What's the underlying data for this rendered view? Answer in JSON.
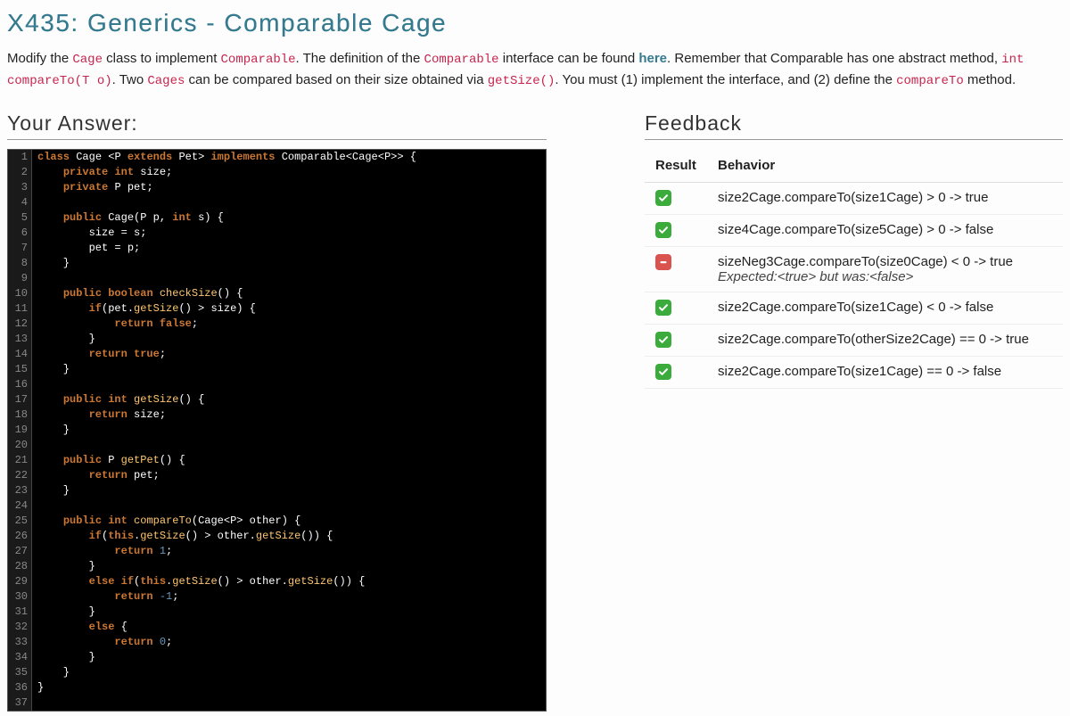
{
  "title": "X435: Generics - Comparable Cage",
  "instructions": {
    "p1a": "Modify the ",
    "code1": "Cage",
    "p1b": " class to implement ",
    "code2": "Comparable",
    "p1c": ". The definition of the ",
    "code3": "Comparable",
    "p1d": " interface can be found ",
    "here": "here",
    "p1e": ". Remember that Comparable has one abstract method, ",
    "code4": "int compareTo(T o)",
    "p1f": ". Two ",
    "code5": "Cages",
    "p1g": " can be compared based on their size obtained via ",
    "code6": "getSize()",
    "p1h": ". You must (1) implement the interface, and (2) define the ",
    "code7": "compareTo",
    "p1i": " method."
  },
  "answer_heading": "Your Answer:",
  "feedback_heading": "Feedback",
  "code_lines": [
    "class Cage <P extends Pet> implements Comparable<Cage<P>> {",
    "    private int size;",
    "    private P pet;",
    "",
    "    public Cage(P p, int s) {",
    "        size = s;",
    "        pet = p;",
    "    }",
    "",
    "    public boolean checkSize() {",
    "        if(pet.getSize() > size) {",
    "            return false;",
    "        }",
    "        return true;",
    "    }",
    "",
    "    public int getSize() {",
    "        return size;",
    "    }",
    "",
    "    public P getPet() {",
    "        return pet;",
    "    }",
    "",
    "    public int compareTo(Cage<P> other) {",
    "        if(this.getSize() > other.getSize()) {",
    "            return 1;",
    "        }",
    "        else if(this.getSize() > other.getSize()) {",
    "            return -1;",
    "        }",
    "        else {",
    "            return 0;",
    "        }",
    "    }",
    "}",
    ""
  ],
  "fb_headers": {
    "result": "Result",
    "behavior": "Behavior"
  },
  "feedback": [
    {
      "status": "pass",
      "text": "size2Cage.compareTo(size1Cage) > 0 -> true"
    },
    {
      "status": "pass",
      "text": "size4Cage.compareTo(size5Cage) > 0 -> false"
    },
    {
      "status": "fail",
      "text": "sizeNeg3Cage.compareTo(size0Cage) < 0 -> true",
      "expected": "Expected:<true> but was:<false>"
    },
    {
      "status": "pass",
      "text": "size2Cage.compareTo(size1Cage) < 0 -> false"
    },
    {
      "status": "pass",
      "text": "size2Cage.compareTo(otherSize2Cage) == 0 -> true"
    },
    {
      "status": "pass",
      "text": "size2Cage.compareTo(size1Cage) == 0 -> false"
    }
  ]
}
